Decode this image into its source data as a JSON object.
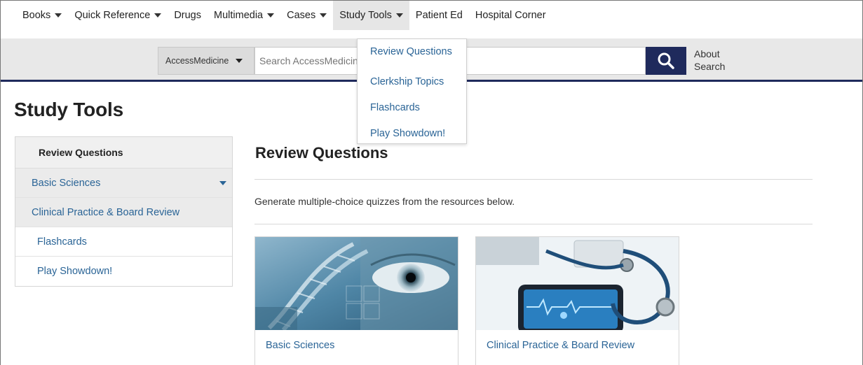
{
  "topnav": {
    "items": [
      {
        "label": "Books",
        "has_caret": true
      },
      {
        "label": "Quick Reference",
        "has_caret": true
      },
      {
        "label": "Drugs",
        "has_caret": false
      },
      {
        "label": "Multimedia",
        "has_caret": true
      },
      {
        "label": "Cases",
        "has_caret": true
      },
      {
        "label": "Study Tools",
        "has_caret": true,
        "active": true
      },
      {
        "label": "Patient Ed",
        "has_caret": false
      },
      {
        "label": "Hospital Corner",
        "has_caret": false
      }
    ]
  },
  "search": {
    "scope_label": "AccessMedicine",
    "placeholder": "Search AccessMedicine",
    "button_icon": "search-icon",
    "about_label": "About Search"
  },
  "dropdown": {
    "items": [
      "Review Questions",
      "Clerkship Topics",
      "Flashcards",
      "Play Showdown!"
    ]
  },
  "page": {
    "title": "Study Tools"
  },
  "sidebar": {
    "header": "Review Questions",
    "items": [
      {
        "label": "Basic Sciences",
        "expandable": true
      },
      {
        "label": "Clinical Practice & Board Review",
        "expandable": false
      },
      {
        "label": "Flashcards",
        "expandable": false
      },
      {
        "label": "Play Showdown!",
        "expandable": false
      }
    ]
  },
  "main": {
    "title": "Review Questions",
    "description": "Generate multiple-choice quizzes from the resources below.",
    "cards": [
      {
        "label": "Basic Sciences",
        "image": "dna-eye-image"
      },
      {
        "label": "Clinical Practice & Board Review",
        "image": "stethoscope-tablet-image"
      }
    ]
  },
  "colors": {
    "brand_navy": "#1f2a5c",
    "link_blue": "#2a6496"
  }
}
